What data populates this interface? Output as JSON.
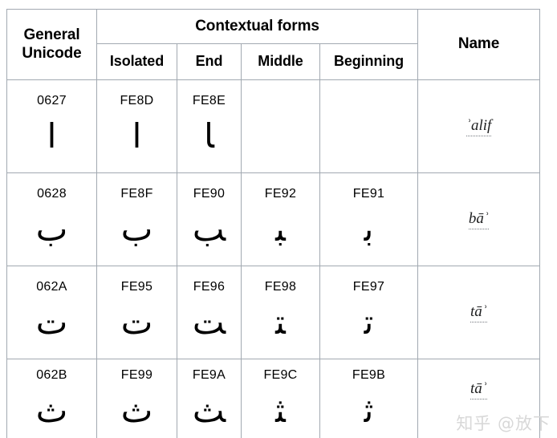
{
  "table": {
    "headers": {
      "general_unicode_line1": "General",
      "general_unicode_line2": "Unicode",
      "contextual_forms": "Contextual forms",
      "isolated": "Isolated",
      "end": "End",
      "middle": "Middle",
      "beginning": "Beginning",
      "name": "Name"
    },
    "rows": [
      {
        "general_unicode": "0627",
        "general_glyph": "ا",
        "isolated_code": "FE8D",
        "isolated_glyph": "ﺍ",
        "end_code": "FE8E",
        "end_glyph": "ﺎ",
        "middle_code": "",
        "middle_glyph": "",
        "beginning_code": "",
        "beginning_glyph": "",
        "name": "ʾalif"
      },
      {
        "general_unicode": "0628",
        "general_glyph": "ب",
        "isolated_code": "FE8F",
        "isolated_glyph": "ﺏ",
        "end_code": "FE90",
        "end_glyph": "ﺐ",
        "middle_code": "FE92",
        "middle_glyph": "ﺒ",
        "beginning_code": "FE91",
        "beginning_glyph": "ﺑ",
        "name": "bāʾ"
      },
      {
        "general_unicode": "062A",
        "general_glyph": "ت",
        "isolated_code": "FE95",
        "isolated_glyph": "ﺕ",
        "end_code": "FE96",
        "end_glyph": "ﺖ",
        "middle_code": "FE98",
        "middle_glyph": "ﺘ",
        "beginning_code": "FE97",
        "beginning_glyph": "ﺗ",
        "name": "tāʾ"
      },
      {
        "general_unicode": "062B",
        "general_glyph": "ث",
        "isolated_code": "FE99",
        "isolated_glyph": "ﺙ",
        "end_code": "FE9A",
        "end_glyph": "ﺚ",
        "middle_code": "FE9C",
        "middle_glyph": "ﺜ",
        "beginning_code": "FE9B",
        "beginning_glyph": "ﺛ",
        "name": "tāʾ"
      }
    ]
  },
  "watermark": {
    "text": "知乎 @放下"
  },
  "colors": {
    "border": "#a2a9b1",
    "text": "#000000",
    "name_text": "#202122",
    "watermark": "#d8d8d8",
    "background": "#ffffff"
  }
}
